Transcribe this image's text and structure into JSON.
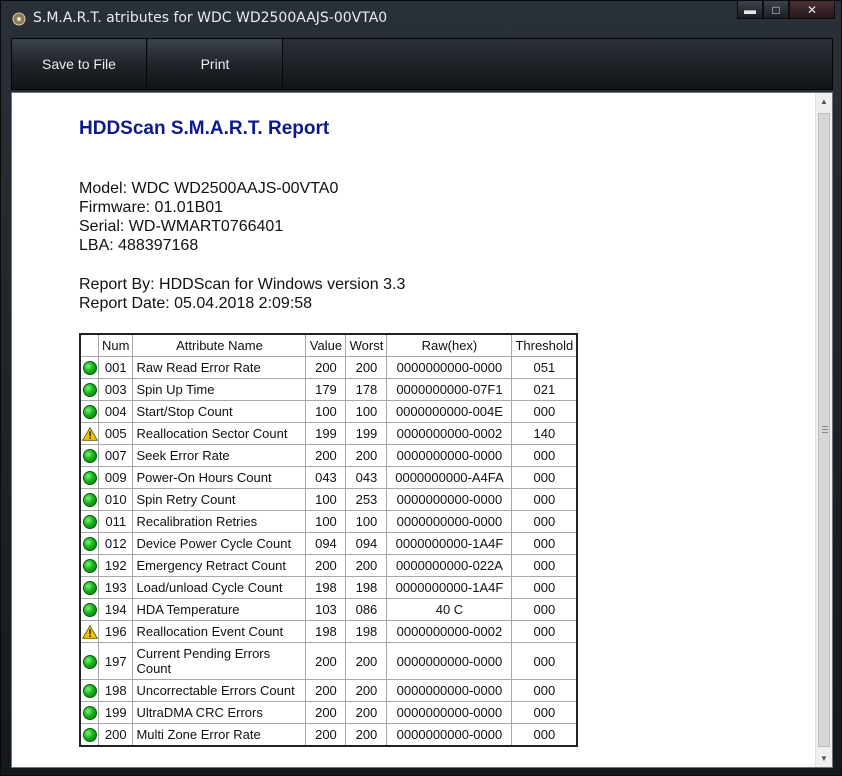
{
  "window": {
    "title": "S.M.A.R.T. atributes for WDC WD2500AAJS-00VTA0",
    "minimize": "▬",
    "maximize": "□",
    "close": "✕"
  },
  "toolbar": {
    "save_label": "Save to File",
    "print_label": "Print"
  },
  "report": {
    "title": "HDDScan S.M.A.R.T. Report",
    "model": "Model: WDC WD2500AAJS-00VTA0",
    "firmware": "Firmware: 01.01B01",
    "serial": "Serial: WD-WMART0766401",
    "lba": "LBA: 488397168",
    "report_by": "Report By: HDDScan for Windows version 3.3",
    "report_date": "Report Date: 05.04.2018 2:09:58"
  },
  "table": {
    "headers": [
      "",
      "Num",
      "Attribute Name",
      "Value",
      "Worst",
      "Raw(hex)",
      "Threshold"
    ],
    "rows": [
      {
        "status": "ok",
        "num": "001",
        "name": "Raw Read Error Rate",
        "value": "200",
        "worst": "200",
        "raw": "0000000000-0000",
        "threshold": "051"
      },
      {
        "status": "ok",
        "num": "003",
        "name": "Spin Up Time",
        "value": "179",
        "worst": "178",
        "raw": "0000000000-07F1",
        "threshold": "021"
      },
      {
        "status": "ok",
        "num": "004",
        "name": "Start/Stop Count",
        "value": "100",
        "worst": "100",
        "raw": "0000000000-004E",
        "threshold": "000"
      },
      {
        "status": "warning",
        "num": "005",
        "name": "Reallocation Sector Count",
        "value": "199",
        "worst": "199",
        "raw": "0000000000-0002",
        "threshold": "140"
      },
      {
        "status": "ok",
        "num": "007",
        "name": "Seek Error Rate",
        "value": "200",
        "worst": "200",
        "raw": "0000000000-0000",
        "threshold": "000"
      },
      {
        "status": "ok",
        "num": "009",
        "name": "Power-On Hours Count",
        "value": "043",
        "worst": "043",
        "raw": "0000000000-A4FA",
        "threshold": "000"
      },
      {
        "status": "ok",
        "num": "010",
        "name": "Spin Retry Count",
        "value": "100",
        "worst": "253",
        "raw": "0000000000-0000",
        "threshold": "000"
      },
      {
        "status": "ok",
        "num": "011",
        "name": "Recalibration Retries",
        "value": "100",
        "worst": "100",
        "raw": "0000000000-0000",
        "threshold": "000"
      },
      {
        "status": "ok",
        "num": "012",
        "name": "Device Power Cycle Count",
        "value": "094",
        "worst": "094",
        "raw": "0000000000-1A4F",
        "threshold": "000"
      },
      {
        "status": "ok",
        "num": "192",
        "name": "Emergency Retract Count",
        "value": "200",
        "worst": "200",
        "raw": "0000000000-022A",
        "threshold": "000"
      },
      {
        "status": "ok",
        "num": "193",
        "name": "Load/unload Cycle Count",
        "value": "198",
        "worst": "198",
        "raw": "0000000000-1A4F",
        "threshold": "000"
      },
      {
        "status": "ok",
        "num": "194",
        "name": "HDA Temperature",
        "value": "103",
        "worst": "086",
        "raw": "40 C",
        "threshold": "000"
      },
      {
        "status": "warning",
        "num": "196",
        "name": "Reallocation Event Count",
        "value": "198",
        "worst": "198",
        "raw": "0000000000-0002",
        "threshold": "000"
      },
      {
        "status": "ok",
        "num": "197",
        "name": "Current Pending Errors Count",
        "value": "200",
        "worst": "200",
        "raw": "0000000000-0000",
        "threshold": "000"
      },
      {
        "status": "ok",
        "num": "198",
        "name": "Uncorrectable Errors Count",
        "value": "200",
        "worst": "200",
        "raw": "0000000000-0000",
        "threshold": "000"
      },
      {
        "status": "ok",
        "num": "199",
        "name": "UltraDMA CRC Errors",
        "value": "200",
        "worst": "200",
        "raw": "0000000000-0000",
        "threshold": "000"
      },
      {
        "status": "ok",
        "num": "200",
        "name": "Multi Zone Error Rate",
        "value": "200",
        "worst": "200",
        "raw": "0000000000-0000",
        "threshold": "000"
      }
    ]
  },
  "icons": {
    "ok": "green-status-icon",
    "warning": "warning-icon"
  },
  "colors": {
    "title": "#0b1a8a",
    "ok": "#19b319",
    "warning": "#f5c400"
  }
}
